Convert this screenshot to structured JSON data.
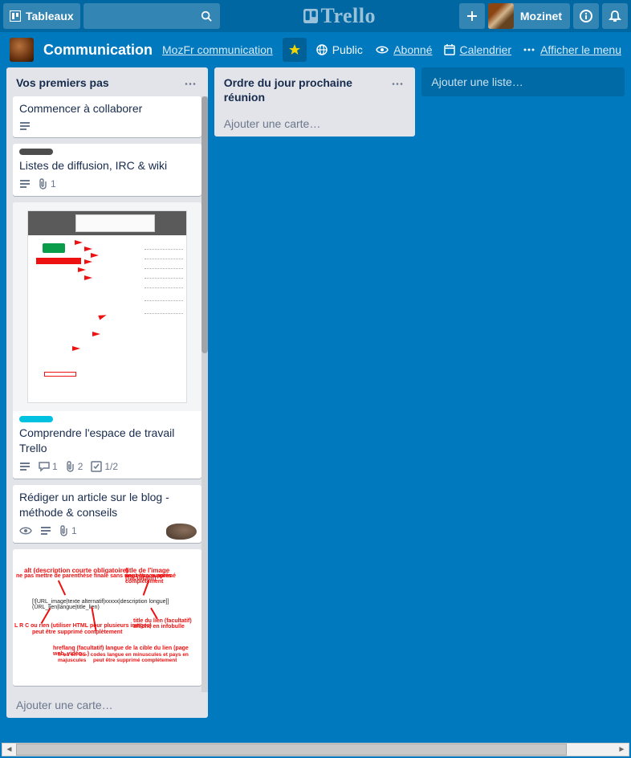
{
  "header": {
    "boards_btn": "Tableaux",
    "user_name": "Mozinet",
    "logo": "Trello"
  },
  "board": {
    "title": "Communication",
    "org": "MozFr communication",
    "visibility": "Public",
    "subscribed": "Abonné",
    "calendar": "Calendrier",
    "show_menu": "Afficher le menu"
  },
  "lists": [
    {
      "title": "Vos premiers pas",
      "add_card": "Ajouter une carte…",
      "cards": [
        {
          "title": "Commencer à collaborer",
          "badges": {
            "desc": true
          }
        },
        {
          "label_color": "#4d4d4d",
          "title": "Listes de diffusion, IRC & wiki",
          "badges": {
            "desc": true,
            "attach": "1"
          }
        },
        {
          "cover": "annotated-screenshot-1",
          "label_color": "#00c2e0",
          "title": "Comprendre l'espace de travail Trello",
          "badges": {
            "desc": true,
            "comments": "1",
            "attach": "2",
            "checklist": "1/2"
          }
        },
        {
          "title": "Rédiger un article sur le blog - méthode & conseils",
          "badges": {
            "watch": true,
            "desc": true,
            "attach": "1"
          },
          "lizard": true
        },
        {
          "cover": "annotated-screenshot-2"
        }
      ]
    },
    {
      "title": "Ordre du jour prochaine réunion",
      "add_card": "Ajouter une carte…",
      "cards": []
    }
  ],
  "add_list": "Ajouter une liste…"
}
